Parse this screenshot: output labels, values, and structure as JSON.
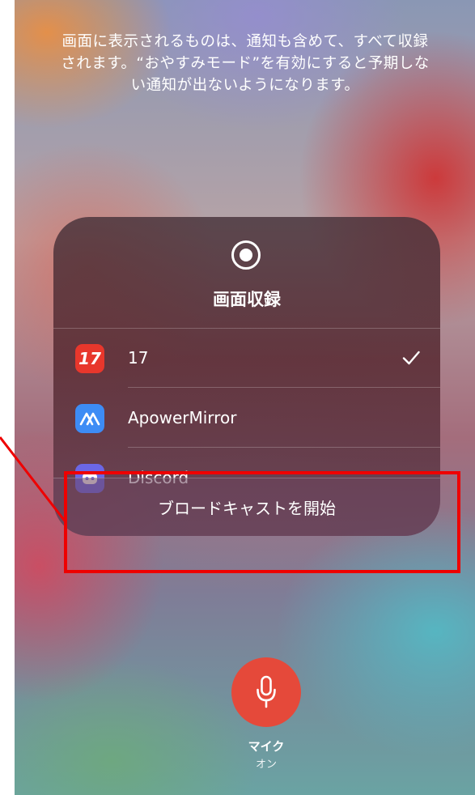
{
  "notice": {
    "text": "画面に表示されるものは、通知も含めて、すべて収録されます。“おやすみモード”を有効にすると予期しない通知が出ないようになります。"
  },
  "panel": {
    "title": "画面収録",
    "icon": "screen-record-icon",
    "apps": [
      {
        "label": "17",
        "icon_text": "17",
        "icon": "app-17-icon",
        "icon_color": "#e8372c",
        "selected": true
      },
      {
        "label": "ApowerMirror",
        "icon_text": "",
        "icon": "apowermirror-icon",
        "icon_color": "#3d8cf5",
        "selected": false
      },
      {
        "label": "Discord",
        "icon_text": "",
        "icon": "discord-icon",
        "icon_color": "#6b67e6",
        "selected": false
      }
    ],
    "broadcast_label": "ブロードキャストを開始"
  },
  "mic": {
    "label": "マイク",
    "status": "オン",
    "color": "#e5493a",
    "icon": "microphone-icon"
  },
  "annotation": {
    "color": "#ee0000"
  }
}
